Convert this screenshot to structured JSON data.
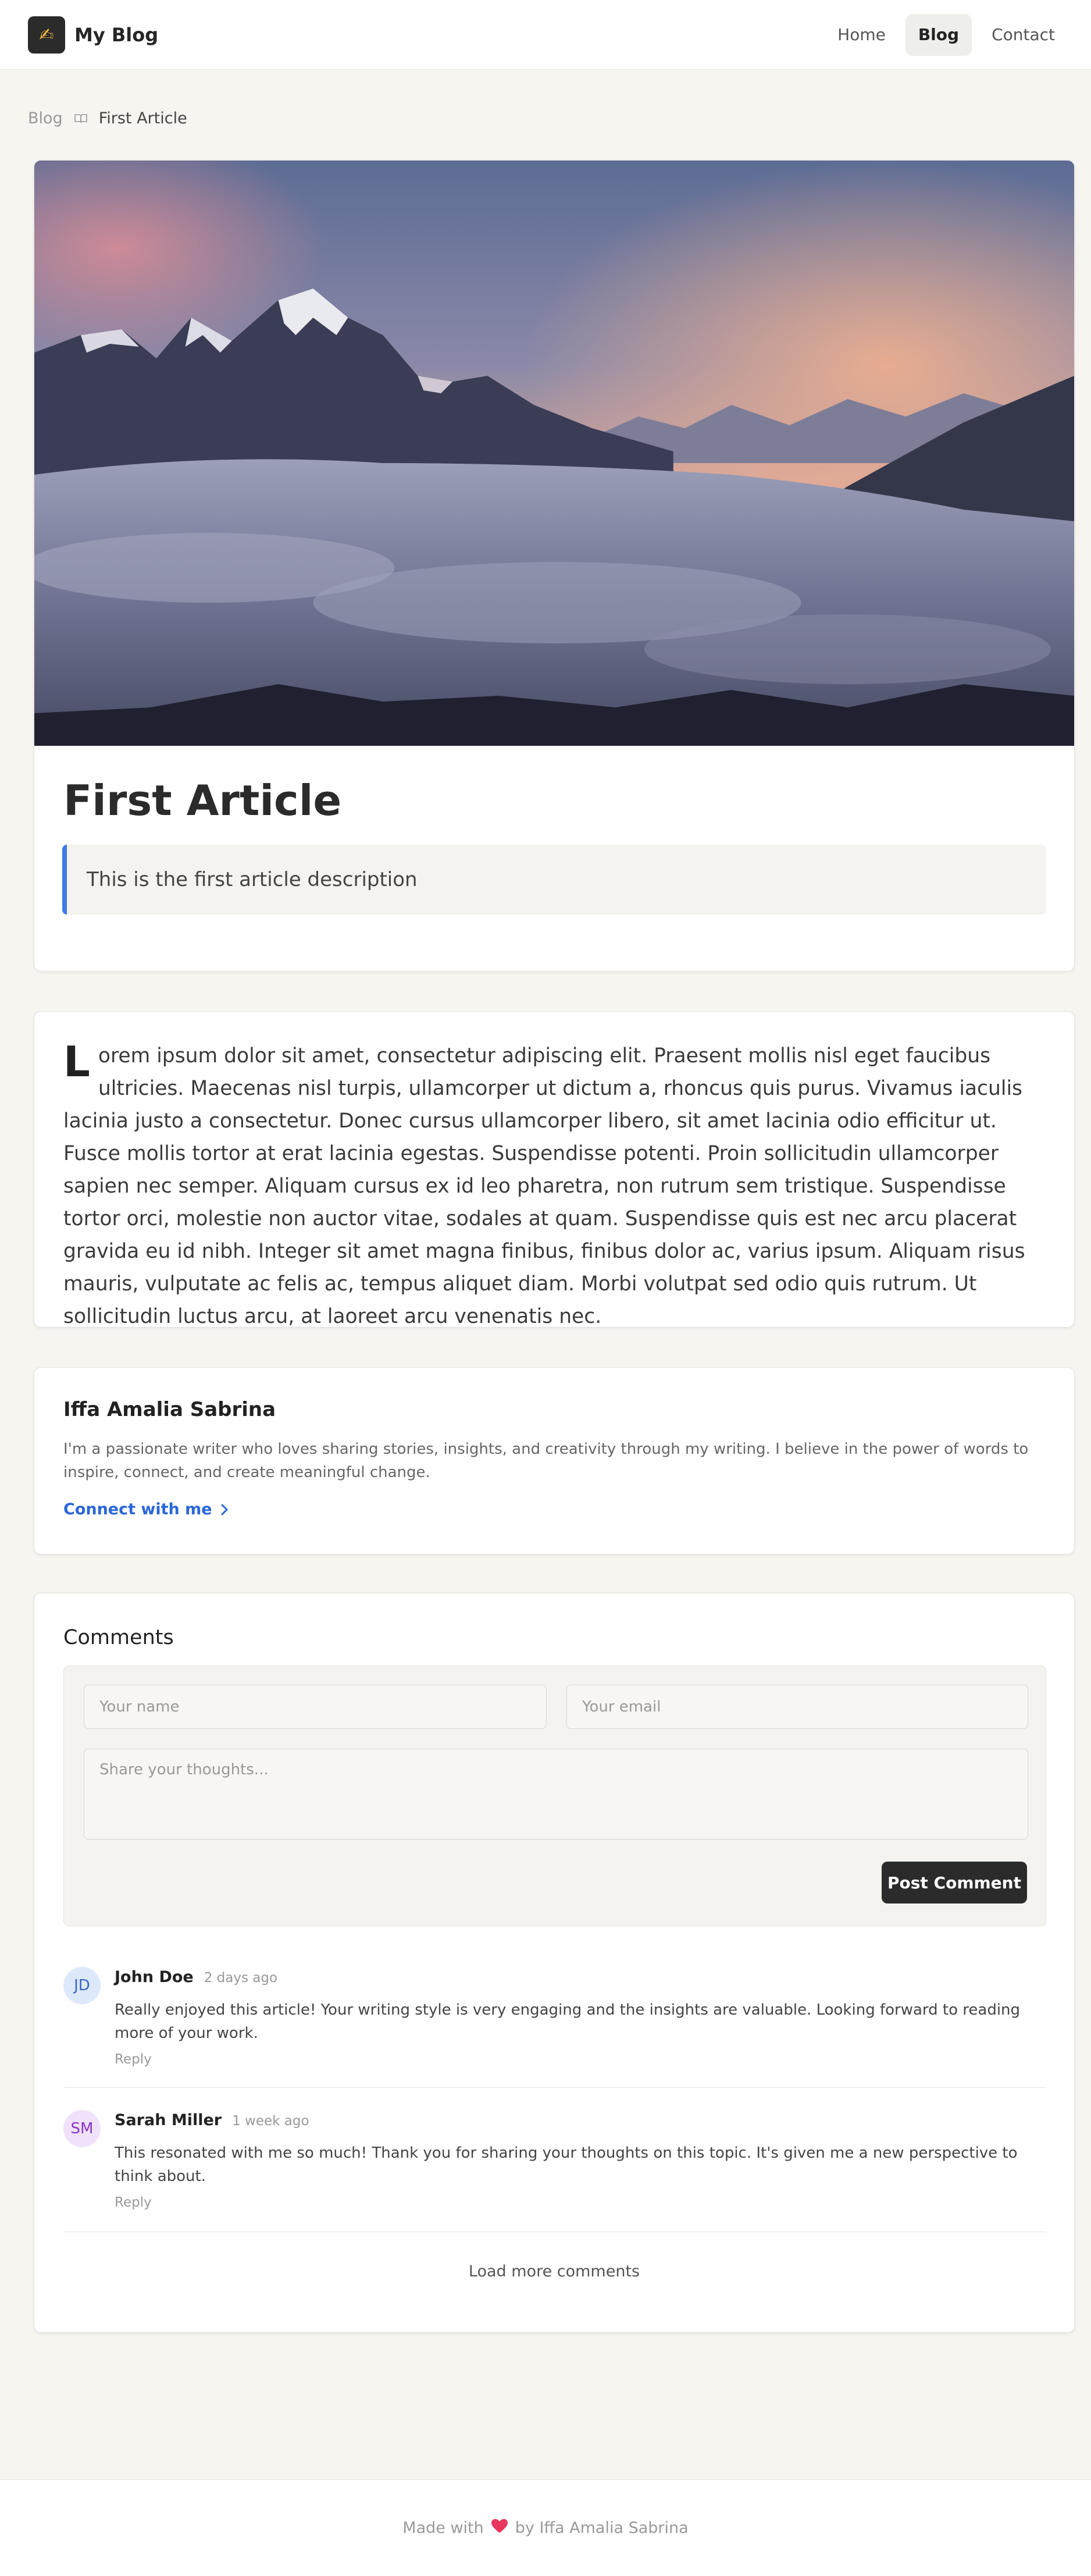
{
  "header": {
    "logo_emoji": "✍",
    "brand": "My Blog",
    "nav": [
      {
        "label": "Home"
      },
      {
        "label": "Blog"
      },
      {
        "label": "Contact"
      }
    ],
    "active_nav": "Blog"
  },
  "breadcrumb": {
    "parent": "Blog",
    "current": "First Article"
  },
  "article": {
    "title": "First Article",
    "description": "This is the first article description",
    "drop_cap": "L",
    "body": "orem ipsum dolor sit amet, consectetur adipiscing elit. Praesent mollis nisl eget faucibus ultricies. Maecenas nisl turpis, ullamcorper ut dictum a, rhoncus quis purus. Vivamus iaculis lacinia justo a consectetur. Donec cursus ullamcorper libero, sit amet lacinia odio efficitur ut. Fusce mollis tortor at erat lacinia egestas. Suspendisse potenti. Proin sollicitudin ullamcorper sapien nec semper. Aliquam cursus ex id leo pharetra, non rutrum sem tristique. Suspendisse tortor orci, molestie non auctor vitae, sodales at quam. Suspendisse quis est nec arcu placerat gravida eu id nibh. Integer sit amet magna finibus, finibus dolor ac, varius ipsum. Aliquam risus mauris, vulputate ac felis ac, tempus aliquet diam. Morbi volutpat sed odio quis rutrum. Ut sollicitudin luctus arcu, at laoreet arcu venenatis nec."
  },
  "author": {
    "name": "Iffa Amalia Sabrina",
    "bio": "I'm a passionate writer who loves sharing stories, insights, and creativity through my writing. I believe in the power of words to inspire, connect, and create meaningful change.",
    "connect_label": "Connect with me"
  },
  "comments": {
    "title": "Comments",
    "form": {
      "name_placeholder": "Your name",
      "email_placeholder": "Your email",
      "message_placeholder": "Share your thoughts...",
      "submit_label": "Post Comment"
    },
    "items": [
      {
        "initials": "JD",
        "name": "John Doe",
        "time": "2 days ago",
        "text": "Really enjoyed this article! Your writing style is very engaging and the insights are valuable. Looking forward to reading more of your work.",
        "reply_label": "Reply"
      },
      {
        "initials": "SM",
        "name": "Sarah Miller",
        "time": "1 week ago",
        "text": "This resonated with me so much! Thank you for sharing your thoughts on this topic. It's given me a new perspective to think about.",
        "reply_label": "Reply"
      }
    ],
    "load_more_label": "Load more comments"
  },
  "footer": {
    "made_with": "Made with",
    "heart": "❤",
    "by": "by Iffa Amalia Sabrina"
  },
  "colors": {
    "accent": "#3b7be6",
    "link": "#2a66d9",
    "page_bg": "#f6f5f0",
    "button_dark": "#2b2b2b",
    "heart": "#e8375e"
  }
}
